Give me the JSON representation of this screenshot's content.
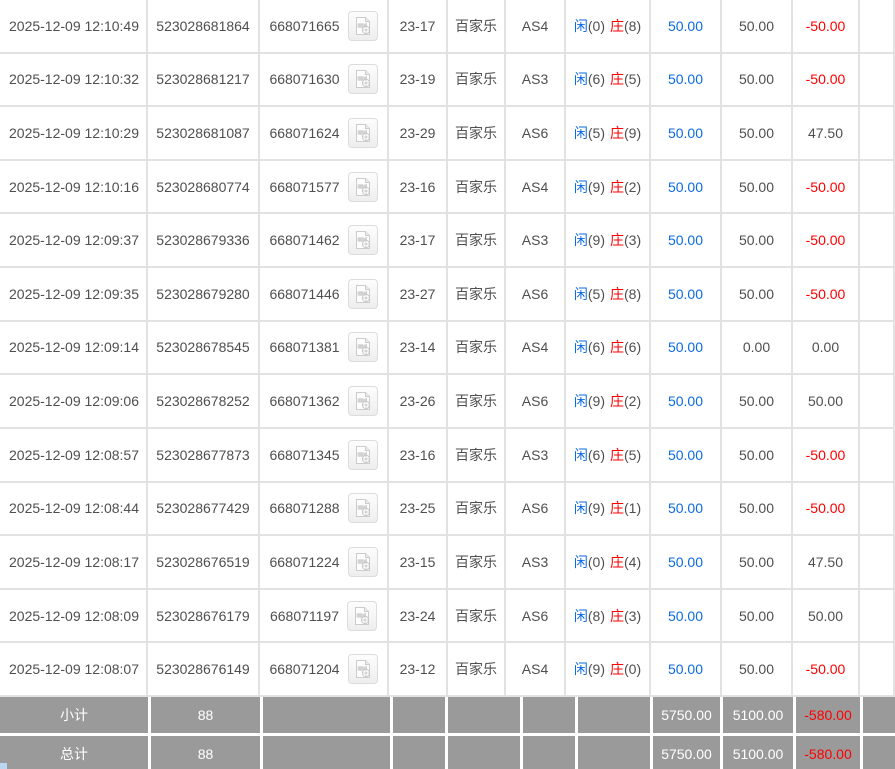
{
  "colors": {
    "accent_blue": "#0c6ae2",
    "negative_red": "#fe0000",
    "body_text": "#4f4f4f",
    "grid_border": "#e2e2e2",
    "summary_bg": "#9a9a9a",
    "summary_text": "#ffffff"
  },
  "icons": {
    "record_video": "video-file-icon"
  },
  "table": {
    "rows": [
      {
        "time": "2025-12-09 12:10:49",
        "bet_no": "523028681864",
        "round_no": "668071665",
        "shoe": "23-17",
        "game": "百家乐",
        "table": "AS4",
        "player": "闲",
        "player_n": "(0)",
        "banker": "庄",
        "banker_n": "(8)",
        "bet": "50.00",
        "valid": "50.00",
        "win": "-50.00"
      },
      {
        "time": "2025-12-09 12:10:32",
        "bet_no": "523028681217",
        "round_no": "668071630",
        "shoe": "23-19",
        "game": "百家乐",
        "table": "AS3",
        "player": "闲",
        "player_n": "(6)",
        "banker": "庄",
        "banker_n": "(5)",
        "bet": "50.00",
        "valid": "50.00",
        "win": "-50.00"
      },
      {
        "time": "2025-12-09 12:10:29",
        "bet_no": "523028681087",
        "round_no": "668071624",
        "shoe": "23-29",
        "game": "百家乐",
        "table": "AS6",
        "player": "闲",
        "player_n": "(5)",
        "banker": "庄",
        "banker_n": "(9)",
        "bet": "50.00",
        "valid": "50.00",
        "win": "47.50"
      },
      {
        "time": "2025-12-09 12:10:16",
        "bet_no": "523028680774",
        "round_no": "668071577",
        "shoe": "23-16",
        "game": "百家乐",
        "table": "AS4",
        "player": "闲",
        "player_n": "(9)",
        "banker": "庄",
        "banker_n": "(2)",
        "bet": "50.00",
        "valid": "50.00",
        "win": "-50.00"
      },
      {
        "time": "2025-12-09 12:09:37",
        "bet_no": "523028679336",
        "round_no": "668071462",
        "shoe": "23-17",
        "game": "百家乐",
        "table": "AS3",
        "player": "闲",
        "player_n": "(9)",
        "banker": "庄",
        "banker_n": "(3)",
        "bet": "50.00",
        "valid": "50.00",
        "win": "-50.00"
      },
      {
        "time": "2025-12-09 12:09:35",
        "bet_no": "523028679280",
        "round_no": "668071446",
        "shoe": "23-27",
        "game": "百家乐",
        "table": "AS6",
        "player": "闲",
        "player_n": "(5)",
        "banker": "庄",
        "banker_n": "(8)",
        "bet": "50.00",
        "valid": "50.00",
        "win": "-50.00"
      },
      {
        "time": "2025-12-09 12:09:14",
        "bet_no": "523028678545",
        "round_no": "668071381",
        "shoe": "23-14",
        "game": "百家乐",
        "table": "AS4",
        "player": "闲",
        "player_n": "(6)",
        "banker": "庄",
        "banker_n": "(6)",
        "bet": "50.00",
        "valid": "0.00",
        "win": "0.00"
      },
      {
        "time": "2025-12-09 12:09:06",
        "bet_no": "523028678252",
        "round_no": "668071362",
        "shoe": "23-26",
        "game": "百家乐",
        "table": "AS6",
        "player": "闲",
        "player_n": "(9)",
        "banker": "庄",
        "banker_n": "(2)",
        "bet": "50.00",
        "valid": "50.00",
        "win": "50.00"
      },
      {
        "time": "2025-12-09 12:08:57",
        "bet_no": "523028677873",
        "round_no": "668071345",
        "shoe": "23-16",
        "game": "百家乐",
        "table": "AS3",
        "player": "闲",
        "player_n": "(6)",
        "banker": "庄",
        "banker_n": "(5)",
        "bet": "50.00",
        "valid": "50.00",
        "win": "-50.00"
      },
      {
        "time": "2025-12-09 12:08:44",
        "bet_no": "523028677429",
        "round_no": "668071288",
        "shoe": "23-25",
        "game": "百家乐",
        "table": "AS6",
        "player": "闲",
        "player_n": "(9)",
        "banker": "庄",
        "banker_n": "(1)",
        "bet": "50.00",
        "valid": "50.00",
        "win": "-50.00"
      },
      {
        "time": "2025-12-09 12:08:17",
        "bet_no": "523028676519",
        "round_no": "668071224",
        "shoe": "23-15",
        "game": "百家乐",
        "table": "AS3",
        "player": "闲",
        "player_n": "(0)",
        "banker": "庄",
        "banker_n": "(4)",
        "bet": "50.00",
        "valid": "50.00",
        "win": "47.50"
      },
      {
        "time": "2025-12-09 12:08:09",
        "bet_no": "523028676179",
        "round_no": "668071197",
        "shoe": "23-24",
        "game": "百家乐",
        "table": "AS6",
        "player": "闲",
        "player_n": "(8)",
        "banker": "庄",
        "banker_n": "(3)",
        "bet": "50.00",
        "valid": "50.00",
        "win": "50.00"
      },
      {
        "time": "2025-12-09 12:08:07",
        "bet_no": "523028676149",
        "round_no": "668071204",
        "shoe": "23-12",
        "game": "百家乐",
        "table": "AS4",
        "player": "闲",
        "player_n": "(9)",
        "banker": "庄",
        "banker_n": "(0)",
        "bet": "50.00",
        "valid": "50.00",
        "win": "-50.00"
      }
    ],
    "summary": {
      "subtotal": {
        "label": "小计",
        "count": "88",
        "bet": "5750.00",
        "valid": "5100.00",
        "win": "-580.00"
      },
      "total": {
        "label": "总计",
        "count": "88",
        "bet": "5750.00",
        "valid": "5100.00",
        "win": "-580.00"
      }
    }
  }
}
